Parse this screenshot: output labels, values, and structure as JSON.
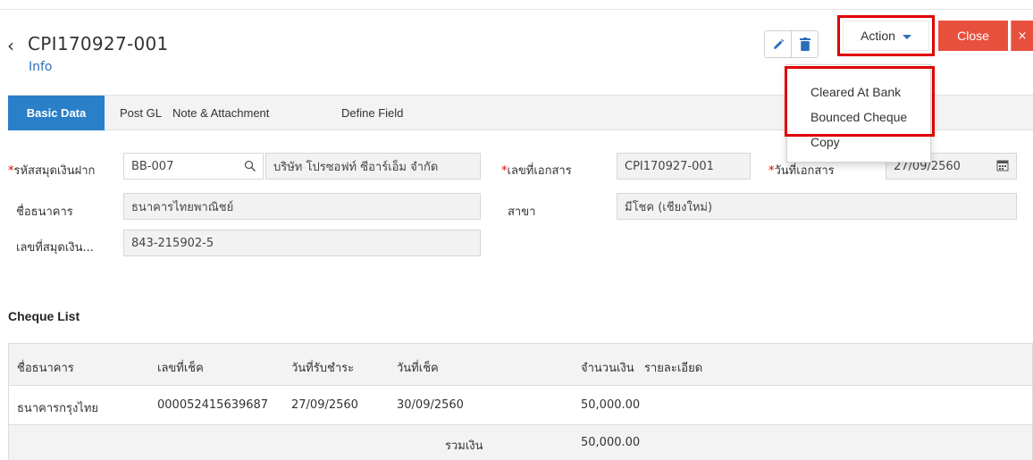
{
  "header": {
    "back_icon": "chevron-left-icon",
    "title": "CPI170927-001",
    "subtitle": "Info",
    "edit_icon": "pencil-icon",
    "delete_icon": "trash-icon",
    "action_label": "Action",
    "close_label": "Close",
    "close_x": "×"
  },
  "colors": {
    "accent": "#2a7fc9",
    "close": "#e8503e",
    "highlight": "#e00000",
    "link": "#2a6ebb"
  },
  "action_menu": {
    "items": [
      "Cleared At Bank",
      "Bounced Cheque",
      "Copy"
    ]
  },
  "tabs": [
    "Basic Data",
    "Post GL",
    "Note & Attachment",
    "Define Field"
  ],
  "form": {
    "bank_book_code_label": "รหัสสมุดเงินฝาก",
    "bank_book_code_value": "BB-007",
    "company_value": "บริษัท โปรซอฟท์ ซีอาร์เอ็ม จำกัด",
    "doc_no_label": "เลขที่เอกสาร",
    "doc_no_value": "CPI170927-001",
    "doc_date_label": "วันที่เอกสาร",
    "doc_date_value": "27/09/2560",
    "bank_name_label": "ชื่อธนาคาร",
    "bank_name_value": "ธนาคารไทยพาณิชย์",
    "branch_label": "สาขา",
    "branch_value": "มีโชค (เชียงใหม่)",
    "account_no_label": "เลขที่สมุดเงิน...",
    "account_no_value": "843-215902-5",
    "required_mark": "*"
  },
  "cheque_list": {
    "title": "Cheque List",
    "columns": [
      "ชื่อธนาคาร",
      "เลขที่เช็ค",
      "วันที่รับชำระ",
      "วันที่เช็ค",
      "จำนวนเงิน",
      "รายละเอียด"
    ],
    "rows": [
      [
        "ธนาคารกรุงไทย",
        "000052415639687",
        "27/09/2560",
        "30/09/2560",
        "50,000.00",
        ""
      ]
    ],
    "total_label": "รวมเงิน",
    "total_value": "50,000.00"
  }
}
